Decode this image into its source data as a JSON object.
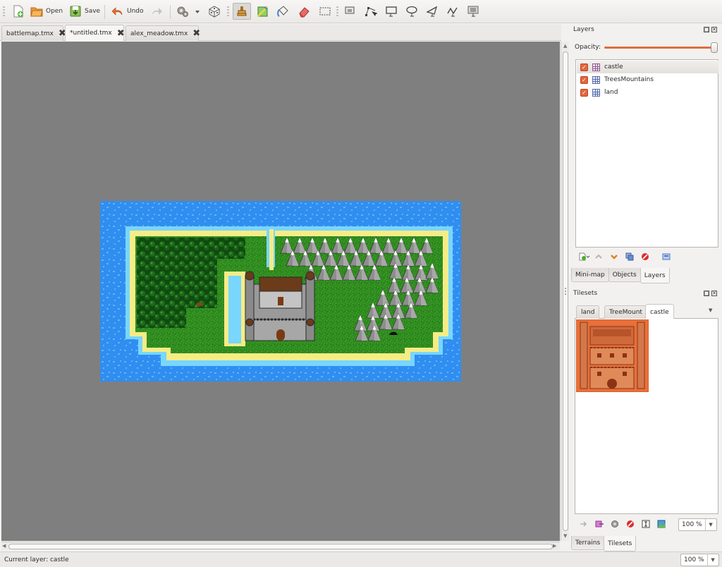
{
  "toolbar": {
    "open_label": "Open",
    "save_label": "Save",
    "undo_label": "Undo"
  },
  "doc_tabs": [
    {
      "label": "battlemap.tmx"
    },
    {
      "label": "*untitled.tmx"
    },
    {
      "label": "alex_meadow.tmx"
    }
  ],
  "layers_panel": {
    "title": "Layers",
    "opacity_label": "Opacity:",
    "opacity": 1.0,
    "layers": [
      {
        "name": "castle",
        "visible": true,
        "selected": true
      },
      {
        "name": "TreesMountains",
        "visible": true,
        "selected": false
      },
      {
        "name": "land",
        "visible": true,
        "selected": false
      }
    ],
    "tabs": [
      {
        "label": "Mini-map"
      },
      {
        "label": "Objects"
      },
      {
        "label": "Layers"
      }
    ]
  },
  "tilesets_panel": {
    "title": "Tilesets",
    "tabs": [
      {
        "label": "land"
      },
      {
        "label": "TreeMount"
      },
      {
        "label": "castle"
      }
    ],
    "zoom": "100 %",
    "bottom_tabs": [
      {
        "label": "Terrains"
      },
      {
        "label": "Tilesets"
      }
    ]
  },
  "statusbar": {
    "current_layer": "Current layer: castle",
    "zoom": "100 %"
  },
  "colors": {
    "accent": "#e26b3c",
    "canvas_bg": "#7f7f7f",
    "water": "#2f8ef0",
    "sand": "#f5ec86",
    "grass": "#2f8c1f",
    "forest": "#0f4a0f"
  }
}
